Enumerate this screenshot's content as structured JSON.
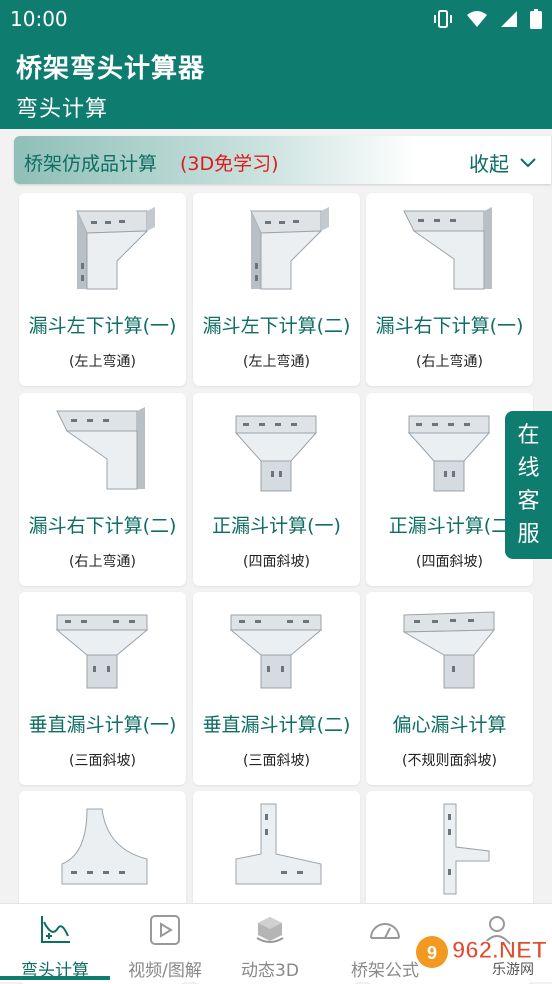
{
  "status_bar": {
    "time": "10:00"
  },
  "header": {
    "title": "桥架弯头计算器",
    "subtitle": "弯头计算"
  },
  "section": {
    "title": "桥架仿成品计算",
    "note": "(3D免学习)",
    "collapse_label": "收起"
  },
  "cards": [
    {
      "title": "漏斗左下计算(一)",
      "subtitle": "(左上弯通)"
    },
    {
      "title": "漏斗左下计算(二)",
      "subtitle": "(左上弯通)"
    },
    {
      "title": "漏斗右下计算(一)",
      "subtitle": "(右上弯通)"
    },
    {
      "title": "漏斗右下计算(二)",
      "subtitle": "(右上弯通)"
    },
    {
      "title": "正漏斗计算(一)",
      "subtitle": "(四面斜坡)"
    },
    {
      "title": "正漏斗计算(二",
      "subtitle": "(四面斜坡)"
    },
    {
      "title": "垂直漏斗计算(一)",
      "subtitle": "(三面斜坡)"
    },
    {
      "title": "垂直漏斗计算(二)",
      "subtitle": "(三面斜坡)"
    },
    {
      "title": "偏心漏斗计算",
      "subtitle": "(不规则面斜坡)"
    },
    {
      "title": "",
      "subtitle": ""
    },
    {
      "title": "",
      "subtitle": ""
    },
    {
      "title": "",
      "subtitle": ""
    }
  ],
  "customer_service": {
    "chars": [
      "在",
      "线",
      "客",
      "服"
    ]
  },
  "bottom_nav": {
    "items": [
      {
        "label": "弯头计算",
        "icon": "chart-curve-icon",
        "active": true
      },
      {
        "label": "视频/图解",
        "icon": "video-play-icon",
        "active": false
      },
      {
        "label": "动态3D",
        "icon": "cube-3d-icon",
        "active": false
      },
      {
        "label": "桥架公式",
        "icon": "gauge-icon",
        "active": false
      },
      {
        "label": "",
        "icon": "user-icon",
        "active": false
      }
    ]
  },
  "watermark": {
    "text": "962.NET",
    "sub": "乐游网"
  },
  "colors": {
    "primary": "#0e7d6f",
    "text_primary": "#0e6e62",
    "note_red": "#e01a1a",
    "inactive": "#888888"
  }
}
